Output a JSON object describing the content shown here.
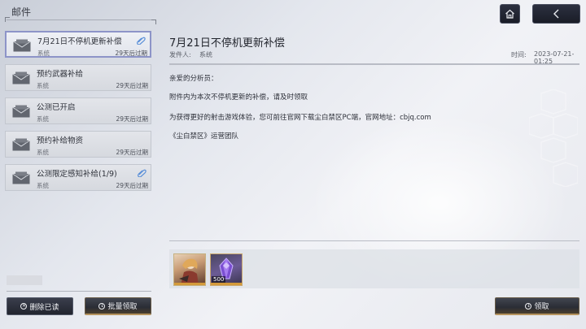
{
  "header": {
    "title": "邮件"
  },
  "mails": [
    {
      "name": "7月21日不停机更新补偿",
      "sender": "系统",
      "expire": "29天后过期",
      "has_attachment": true,
      "selected": true
    },
    {
      "name": "预约武器补给",
      "sender": "系统",
      "expire": "29天后过期",
      "has_attachment": false,
      "selected": false
    },
    {
      "name": "公测已开启",
      "sender": "系统",
      "expire": "29天后过期",
      "has_attachment": false,
      "selected": false
    },
    {
      "name": "预约补给物资",
      "sender": "系统",
      "expire": "29天后过期",
      "has_attachment": false,
      "selected": false
    },
    {
      "name": "公测限定感知补给(1/9)",
      "sender": "系统",
      "expire": "29天后过期",
      "has_attachment": true,
      "selected": false
    }
  ],
  "buttons": {
    "delete_read": "删除已读",
    "batch_claim": "批量领取",
    "claim": "领取"
  },
  "detail": {
    "title": "7月21日不停机更新补偿",
    "sender_label": "发件人:",
    "sender": "系统",
    "time_label": "时间:",
    "time": "2023-07-21-01:25",
    "lines": [
      "亲爱的分析员：",
      "附件内为本次不停机更新的补偿，请及时领取",
      "为获得更好的射击游戏体验，您可前往官网下载尘白禁区PC端，官网地址：cbjq.com",
      "《尘白禁区》运营团队"
    ],
    "attachments": [
      {
        "icon": "character-portrait",
        "count": ""
      },
      {
        "icon": "purple-crystal",
        "count": "500"
      }
    ]
  },
  "colors": {
    "selected_border": "#8d94c8",
    "attachment_icon": "#5a8fd8",
    "reward_bar": "#d49a3a"
  }
}
